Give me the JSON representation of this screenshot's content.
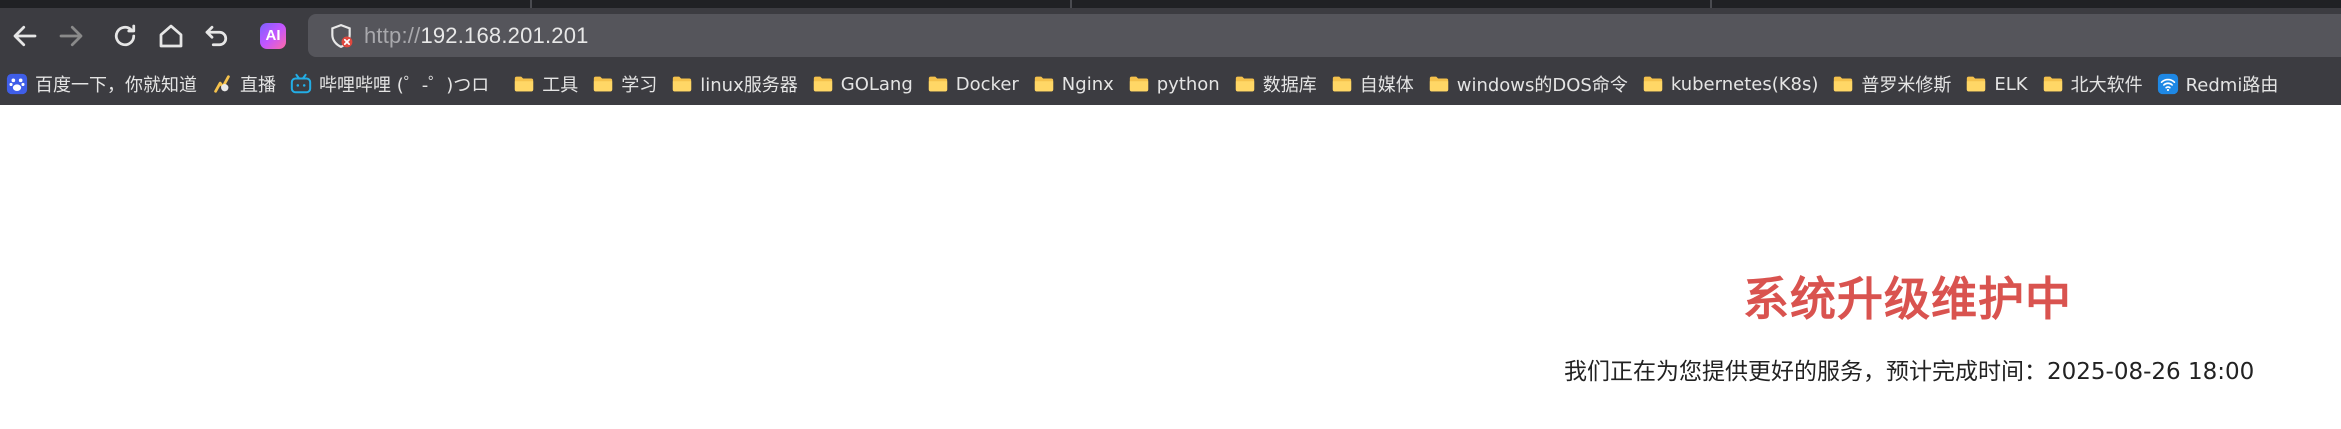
{
  "browser": {
    "url": {
      "scheme": "http://",
      "host": "192.168.201.201"
    },
    "ai_button": {
      "label": "AI"
    }
  },
  "bookmarks": [
    {
      "label": "百度一下，你就知道",
      "icon": "baidu-paw-icon"
    },
    {
      "label": "直播",
      "icon": "live-icon"
    },
    {
      "label": "哔哩哔哩 (゜-゜)つロ",
      "icon": "bilibili-icon"
    },
    {
      "label": "工具",
      "icon": "folder-icon"
    },
    {
      "label": "学习",
      "icon": "folder-icon"
    },
    {
      "label": "linux服务器",
      "icon": "folder-icon"
    },
    {
      "label": "GOLang",
      "icon": "folder-icon"
    },
    {
      "label": "Docker",
      "icon": "folder-icon"
    },
    {
      "label": "Nginx",
      "icon": "folder-icon"
    },
    {
      "label": "python",
      "icon": "folder-icon"
    },
    {
      "label": "数据库",
      "icon": "folder-icon"
    },
    {
      "label": "自媒体",
      "icon": "folder-icon"
    },
    {
      "label": "windows的DOS命令",
      "icon": "folder-icon"
    },
    {
      "label": "kubernetes(K8s)",
      "icon": "folder-icon"
    },
    {
      "label": "普罗米修斯",
      "icon": "folder-icon"
    },
    {
      "label": "ELK",
      "icon": "folder-icon"
    },
    {
      "label": "北大软件",
      "icon": "folder-icon"
    },
    {
      "label": "Redmi路由",
      "icon": "wifi-icon"
    }
  ],
  "page": {
    "title": "系统升级维护中",
    "message": "我们正在为您提供更好的服务，预计完成时间：2025-08-26 18:00"
  },
  "colors": {
    "title": "#d9534f",
    "chrome": "#3c3c41",
    "address_bar": "#55555b",
    "folder": "#f5c24c"
  }
}
